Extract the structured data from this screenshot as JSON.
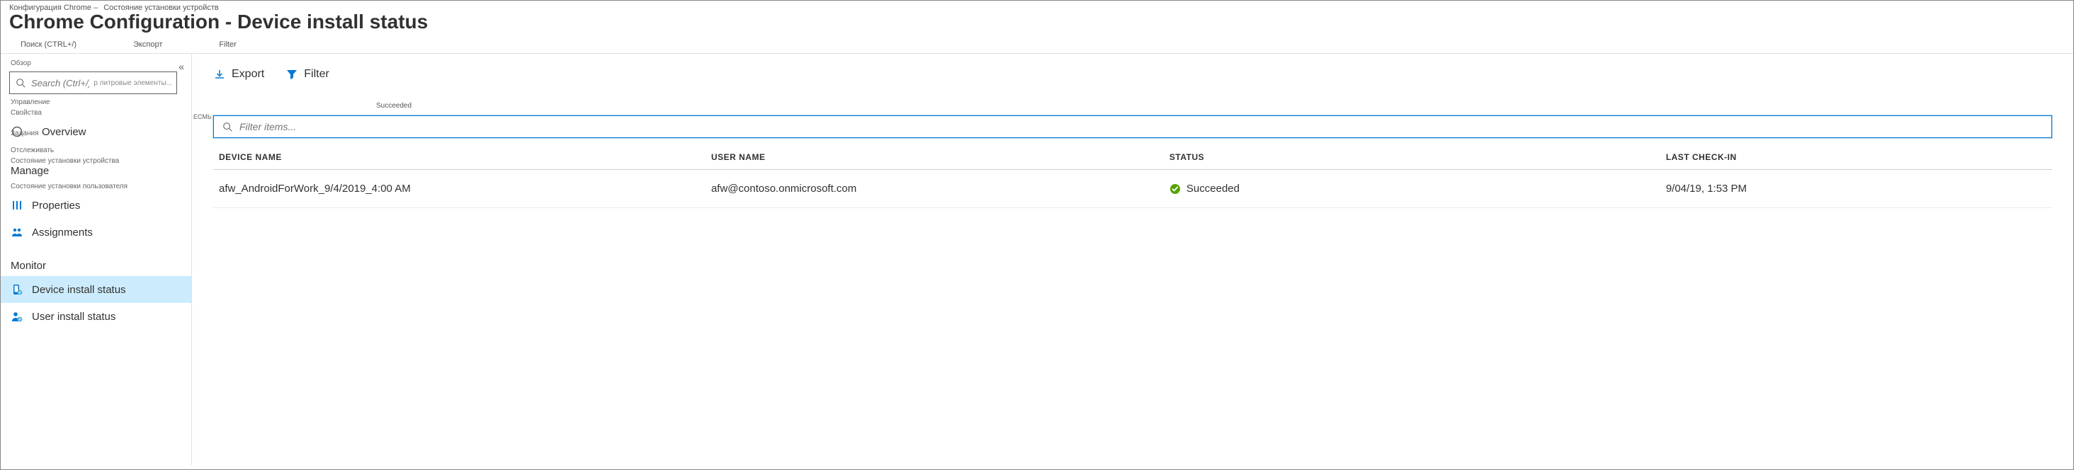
{
  "breadcrumb": {
    "part1": "Конфигурация Chrome –",
    "part2": "Состояние установки устройств"
  },
  "page_title": "Chrome Configuration - Device install status",
  "subtitle": {
    "search_hint": "Поиск (CTRL+/)",
    "export": "Экспорт",
    "filter": "Filter"
  },
  "sidebar": {
    "search_placeholder": "Search (Ctrl+/)",
    "search_trailing": "р литровые элементы...",
    "tiny_labels": {
      "obzor": "Обзор",
      "upravlenie": "Управление",
      "svoistva": "Свойства",
      "zadaniya": "Задания",
      "otslezhivat": "Отслеживать",
      "sostoyanie_ustroistva": "Состояние установки устройства",
      "sostoyanie_polzovatelya": "Состояние установки пользователя"
    },
    "overview": "Overview",
    "manage": "Manage",
    "properties": "Properties",
    "assignments": "Assignments",
    "monitor": "Monitor",
    "device_install_status": "Device install status",
    "user_install_status": "User install status"
  },
  "main": {
    "ecmb": "ЕСМЬ",
    "export": "Export",
    "filter": "Filter",
    "succeeded_mini": "Succeeded",
    "filter_items_placeholder": "Filter items...",
    "columns": {
      "device_name": "DEVICE NAME",
      "user_name": "USER NAME",
      "status": "STATUS",
      "last_check_in": "LAST CHECK-IN"
    },
    "rows": [
      {
        "device_name": "afw_AndroidForWork_9/4/2019_4:00 AM",
        "user_name": "afw@contoso.onmicrosoft.com",
        "status": "Succeeded",
        "last_check_in": "9/04/19, 1:53 PM"
      }
    ]
  }
}
